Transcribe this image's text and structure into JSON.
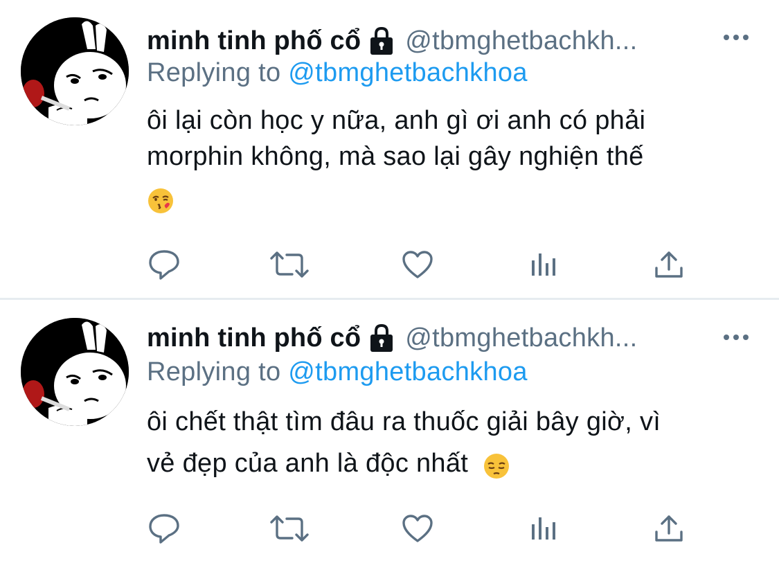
{
  "tweets": [
    {
      "display_name": "minh tinh phố cổ",
      "handle": "@tbmghetbachkh...",
      "replying_prefix": "Replying to",
      "replying_to": "@tbmghetbachkhoa",
      "text_lines": [
        "ôi lại còn học y nữa, anh gì ơi anh có phải",
        "morphin không, mà sao lại gây nghiện thế"
      ],
      "emoji": "face-blowing-kiss-emoji"
    },
    {
      "display_name": "minh tinh phố cổ",
      "handle": "@tbmghetbachkh...",
      "replying_prefix": "Replying to",
      "replying_to": "@tbmghetbachkhoa",
      "text_lines": [
        "ôi chết thật tìm đâu ra thuốc giải bây giờ, vì",
        "vẻ đẹp của anh là độc nhất"
      ],
      "emoji": "pensive-face-emoji"
    }
  ],
  "icons": {
    "reply": "reply-icon",
    "retweet": "retweet-icon",
    "like": "heart-icon",
    "analytics": "analytics-icon",
    "share": "share-icon",
    "lock": "lock-icon",
    "more": "more-icon"
  },
  "colors": {
    "link": "#1d9bf0",
    "secondary_text": "#5b7083",
    "primary_text": "#0f1419",
    "divider": "#e6ecf0"
  }
}
